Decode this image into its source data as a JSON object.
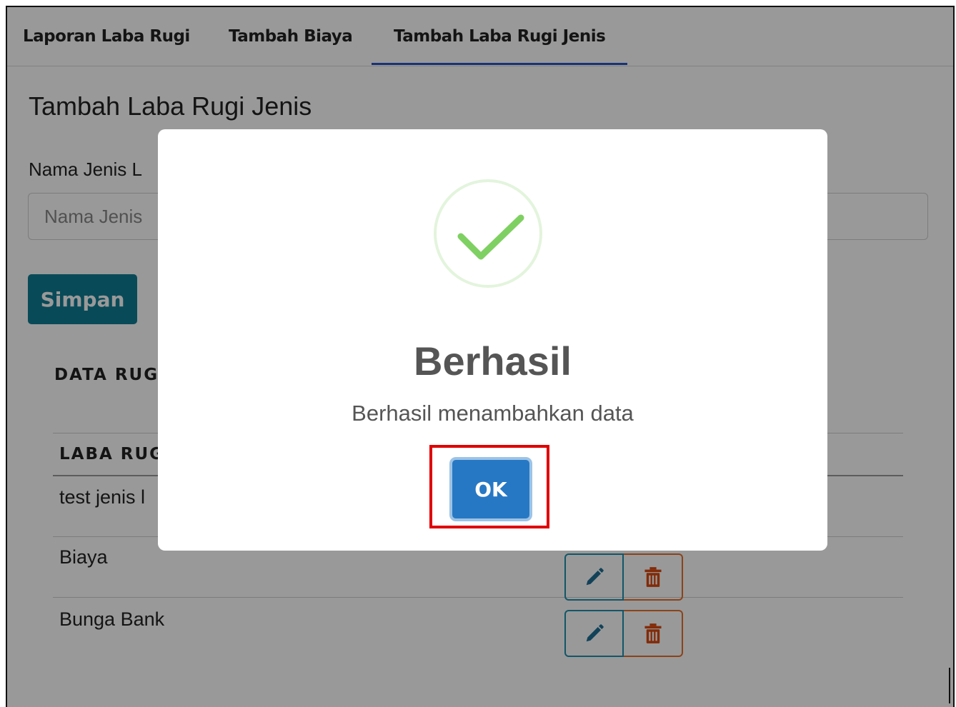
{
  "tabs": [
    {
      "label": "Laporan Laba Rugi"
    },
    {
      "label": "Tambah Biaya"
    },
    {
      "label": "Tambah Laba Rugi Jenis"
    }
  ],
  "form": {
    "title": "Tambah Laba Rugi Jenis",
    "field_label": "Nama Jenis L",
    "input_placeholder": "Nama Jenis",
    "save_label": "Simpan"
  },
  "table": {
    "section_title": "DATA RUGI",
    "header": "LABA RUG",
    "rows": [
      {
        "name": "test jenis l"
      },
      {
        "name": "Biaya"
      },
      {
        "name": "Bunga Bank"
      }
    ]
  },
  "modal": {
    "title": "Berhasil",
    "message": "Berhasil menambahkan data",
    "ok_label": "OK"
  },
  "colors": {
    "primary": "#0f7c93",
    "ok_button": "#2778c4",
    "success": "#7fd062",
    "highlight": "#e00000",
    "edit_border": "#1e8fb0",
    "delete_border": "#e8702a"
  }
}
